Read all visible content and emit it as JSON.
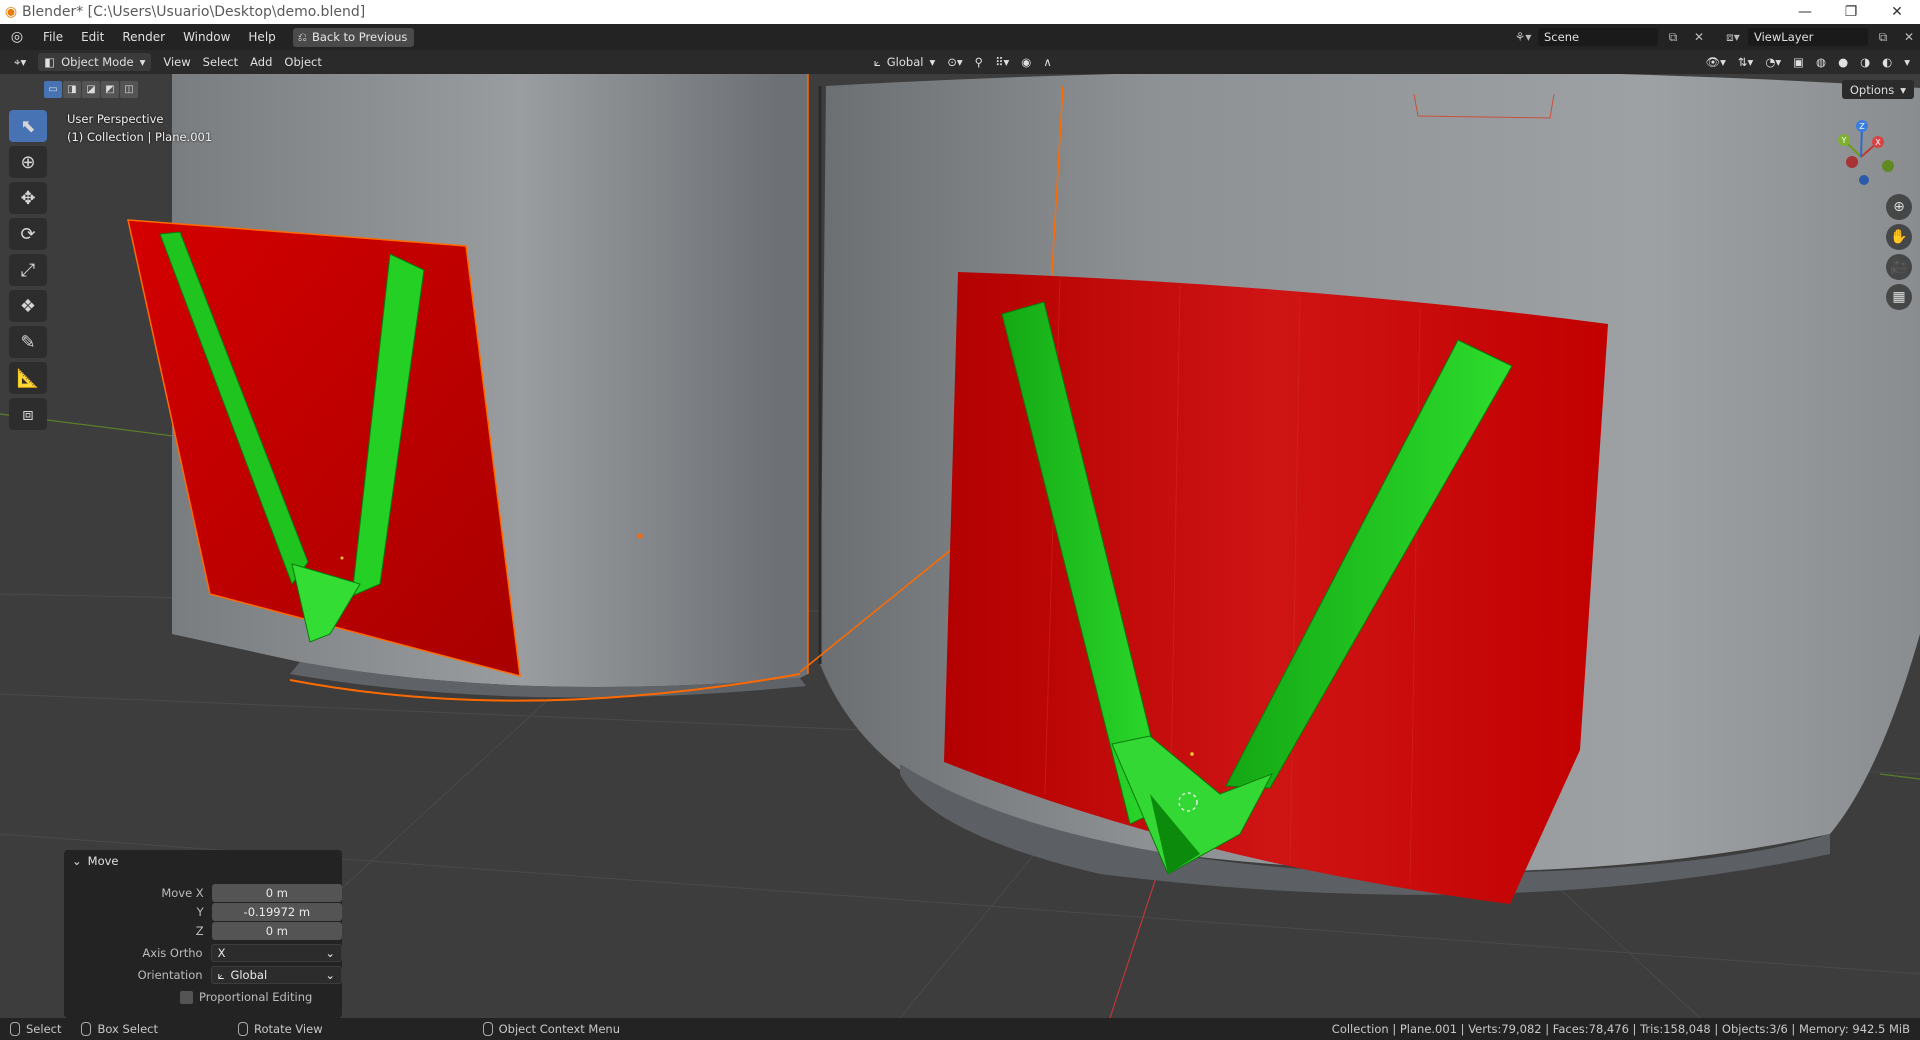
{
  "window": {
    "title": "Blender* [C:\\Users\\Usuario\\Desktop\\demo.blend]",
    "minimize": "—",
    "restore": "❐",
    "close": "✕"
  },
  "topbar": {
    "menus": [
      "File",
      "Edit",
      "Render",
      "Window",
      "Help"
    ],
    "back_button": "Back to Previous",
    "scene_name": "Scene",
    "view_layer": "ViewLayer"
  },
  "header3d": {
    "mode": "Object Mode",
    "menus": [
      "View",
      "Select",
      "Add",
      "Object"
    ],
    "orientation": "Global"
  },
  "viewport": {
    "perspective": "User Perspective",
    "collection_info": "(1) Collection | Plane.001",
    "options_label": "Options",
    "gizmo_axes": [
      "X",
      "Y",
      "Z"
    ],
    "colors": {
      "object_red": "#c40000",
      "strip_green": "#1ecb1e",
      "selection_orange": "#ff6a00",
      "mesh_gray": "#8a8d90"
    }
  },
  "redo_panel": {
    "title": "Move",
    "move_x_label": "Move X",
    "move_x": "0 m",
    "y_label": "Y",
    "y_value": "-0.19972 m",
    "z_label": "Z",
    "z_value": "0 m",
    "axis_ortho_label": "Axis Ortho",
    "axis_ortho_value": "X",
    "orientation_label": "Orientation",
    "orientation_value": "Global",
    "proportional_label": "Proportional Editing"
  },
  "statusbar": {
    "select": "Select",
    "box_select": "Box Select",
    "rotate_view": "Rotate View",
    "context_menu": "Object Context Menu",
    "stats": "Collection | Plane.001 | Verts:79,082 | Faces:78,476 | Tris:158,048 | Objects:3/6 | Memory: 942.5 MiB"
  }
}
